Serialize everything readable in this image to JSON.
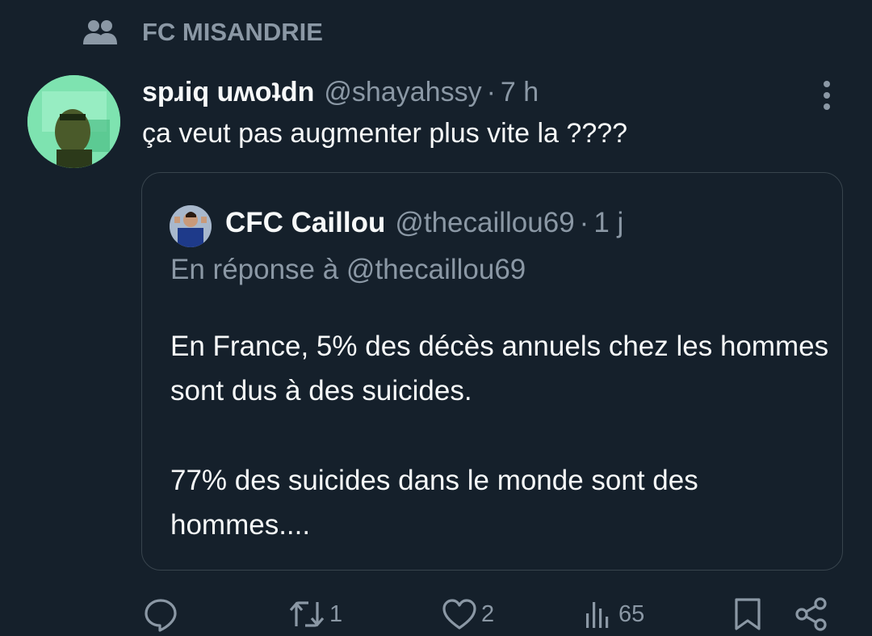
{
  "community": {
    "icon": "people-icon",
    "name": "FC MISANDRIE"
  },
  "tweet": {
    "display_name": "spɹiq uʍoʇdn",
    "handle": "@shayahssy",
    "separator": "·",
    "time": "7 h",
    "text": "ça veut pas augmenter plus vite la ????",
    "more_icon": "more-vertical-icon"
  },
  "quote": {
    "display_name": "CFC Caillou",
    "handle": "@thecaillou69",
    "separator": "·",
    "time": "1 j",
    "reply_to": "En réponse à @thecaillou69",
    "paragraphs": [
      "En France, 5% des décès annuels chez les hommes sont dus à des suicides.",
      "77% des suicides dans le monde sont des hommes...."
    ]
  },
  "actions": {
    "reply": {
      "icon": "reply-icon",
      "count": ""
    },
    "retweet": {
      "icon": "retweet-icon",
      "count": "1"
    },
    "like": {
      "icon": "heart-icon",
      "count": "2"
    },
    "views": {
      "icon": "views-icon",
      "count": "65"
    },
    "bookmark": {
      "icon": "bookmark-icon",
      "count": ""
    },
    "share": {
      "icon": "share-icon",
      "count": ""
    }
  },
  "colors": {
    "background": "#15202b",
    "primary_text": "#f7f9f9",
    "secondary_text": "#8b98a5",
    "border": "#38444d"
  }
}
